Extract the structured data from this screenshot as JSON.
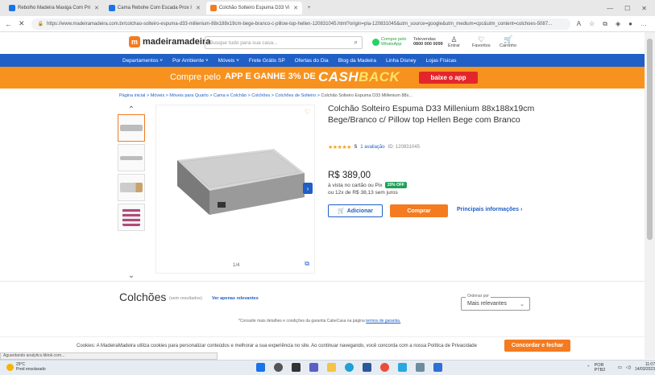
{
  "browser": {
    "tabs": [
      {
        "label": "Rebolho Madeira Maxiga Com Pri"
      },
      {
        "label": "Cama Rebohe Com Escada Prox I"
      },
      {
        "label": "Colchão Solteiro Espuma D33 Vi"
      }
    ],
    "new_tab": "+",
    "url": "https://www.madeiramadeira.com.br/colchao-solteiro-espuma-d33-millenium-88x188x19cm-bege-branco-c-pillow-top-hellen-120831045.html?origin=pla-120831045&utm_source=google&utm_medium=cpc&utm_content=colchoes-5087...",
    "status_text": "Aguardando analytics.tiktok.com..."
  },
  "site": {
    "logo": "madeiramadeira",
    "search_placeholder": "Busque tudo para sua casa...",
    "header": {
      "whatsapp": "Compre pelo WhatsApp",
      "televendas_label": "Televendas",
      "televendas_phone": "0800 000 0099",
      "entrar": "Entrar",
      "favoritos": "Favoritos",
      "carrinho": "Carrinho"
    },
    "nav": [
      "Departamentos ˅",
      "Por Ambiente ˅",
      "Móveis ˅",
      "Frete Grátis SP",
      "Ofertas do Dia",
      "Blog da Madeira",
      "Linha Disney",
      "Lojas Físicas"
    ],
    "promo": {
      "text1": "Compre pelo",
      "text2": "APP E GANHE 3% DE",
      "cash": "CASH",
      "back": "BACK",
      "cta": "baixe o app"
    }
  },
  "breadcrumb": {
    "items": [
      "Página inicial",
      "Móveis",
      "Móveis para Quarto",
      "Cama e Colchão",
      "Colchões",
      "Colchões de Solteiro"
    ],
    "current": "Colchão Solteiro Espuma D33 Millenium 88x..."
  },
  "product": {
    "title": "Colchão Solteiro Espuma D33 Millenium 88x188x19cm Bege/Branco c/ Pillow top Hellen Bege com Branco",
    "rating": "5",
    "reviews": "1 avaliação",
    "id_label": "ID: 120831045",
    "price": "R$ 389,00",
    "pix_text": "à vista no cartão ou Pix",
    "off_badge": "15% OFF",
    "installments": "ou 12x de R$ 38,13 sem juros",
    "add_label": "Adicionar",
    "buy_label": "Comprar",
    "info_label": "Principais informações ›",
    "image_counter": "1/4"
  },
  "section": {
    "title": "Colchões",
    "subtitle": "(sem resultados)",
    "link": "Ver apenas relevantes",
    "sort_label": "Ordenar por",
    "sort_value": "Mais relevantes",
    "note": "*Consulte mais detalhes e condições da garantia CabeCasa na página",
    "note_link": "termos de garantia."
  },
  "cookie": {
    "text": "Cookies: A MadeiraMadeira utiliza cookies para personalizar conteúdos e melhorar a sua experiência no site. Ao continuar navegando, você concorda com a nossa Política de Privacidade",
    "accept": "Concordar e fechar"
  },
  "taskbar": {
    "weather_temp": "29°C",
    "weather_desc": "Pred ensolarado",
    "lang": "POR PTB2",
    "time": "11:07",
    "date": "14/03/2023"
  },
  "colors": {
    "orange": "#f47b20",
    "blue": "#1f5fc6",
    "promo": "#f7921e"
  }
}
